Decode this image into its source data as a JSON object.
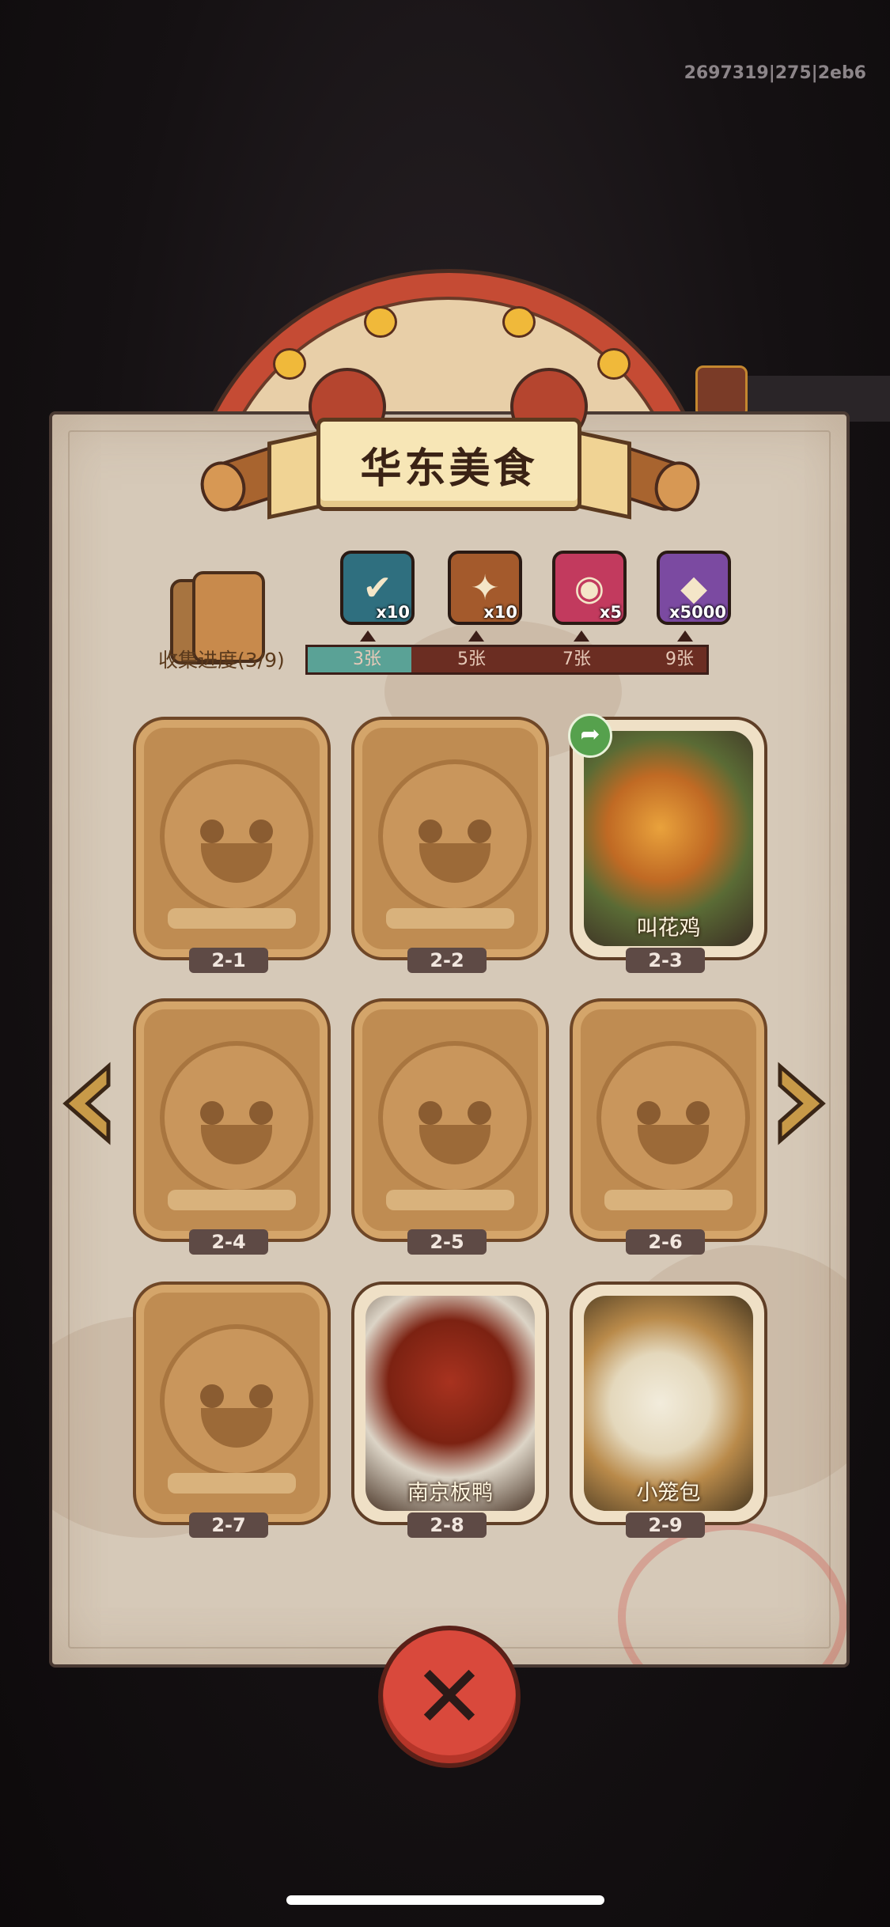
{
  "debug_id": "2697319|275|2eb6",
  "title": "华东美食",
  "progress": {
    "label": "收集进度(3/9)",
    "collected": 3,
    "total": 9,
    "milestones": [
      "3张",
      "5张",
      "7张",
      "9张"
    ]
  },
  "rewards": [
    {
      "icon": "chest-check-icon",
      "qty": "x10",
      "color": "#2f6f7f"
    },
    {
      "icon": "scroll-key-icon",
      "qty": "x10",
      "color": "#a45a2c"
    },
    {
      "icon": "magic-orb-icon",
      "qty": "x5",
      "color": "#c23a5e"
    },
    {
      "icon": "diamond-icon",
      "qty": "x5000",
      "color": "#7b4aa1"
    }
  ],
  "cards": [
    {
      "id": "2-1",
      "collected": false,
      "name": ""
    },
    {
      "id": "2-2",
      "collected": false,
      "name": ""
    },
    {
      "id": "2-3",
      "collected": true,
      "name": "叫花鸡"
    },
    {
      "id": "2-4",
      "collected": false,
      "name": ""
    },
    {
      "id": "2-5",
      "collected": false,
      "name": ""
    },
    {
      "id": "2-6",
      "collected": false,
      "name": ""
    },
    {
      "id": "2-7",
      "collected": false,
      "name": ""
    },
    {
      "id": "2-8",
      "collected": true,
      "name": "南京板鸭"
    },
    {
      "id": "2-9",
      "collected": true,
      "name": "小笼包"
    }
  ],
  "icons": {
    "share": "share-icon",
    "prev": "left-arrow-icon",
    "next": "right-arrow-icon",
    "close": "close-icon"
  }
}
